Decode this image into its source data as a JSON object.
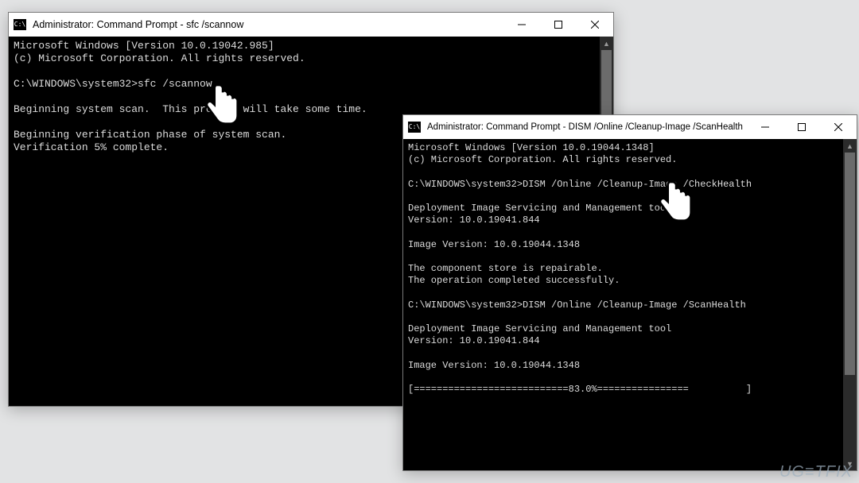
{
  "window1": {
    "title": "Administrator: Command Prompt - sfc  /scannow",
    "lines": [
      "Microsoft Windows [Version 10.0.19042.985]",
      "(c) Microsoft Corporation. All rights reserved.",
      "",
      "C:\\WINDOWS\\system32>sfc /scannow",
      "",
      "Beginning system scan.  This process will take some time.",
      "",
      "Beginning verification phase of system scan.",
      "Verification 5% complete."
    ]
  },
  "window2": {
    "title": "Administrator: Command Prompt - DISM  /Online /Cleanup-Image /ScanHealth",
    "lines": [
      "Microsoft Windows [Version 10.0.19044.1348]",
      "(c) Microsoft Corporation. All rights reserved.",
      "",
      "C:\\WINDOWS\\system32>DISM /Online /Cleanup-Image /CheckHealth",
      "",
      "Deployment Image Servicing and Management tool",
      "Version: 10.0.19041.844",
      "",
      "Image Version: 10.0.19044.1348",
      "",
      "The component store is repairable.",
      "The operation completed successfully.",
      "",
      "C:\\WINDOWS\\system32>DISM /Online /Cleanup-Image /ScanHealth",
      "",
      "Deployment Image Servicing and Management tool",
      "Version: 10.0.19041.844",
      "",
      "Image Version: 10.0.19044.1348",
      "",
      "[===========================83.0%================          ]"
    ]
  },
  "watermark": "UG≡TFIX"
}
